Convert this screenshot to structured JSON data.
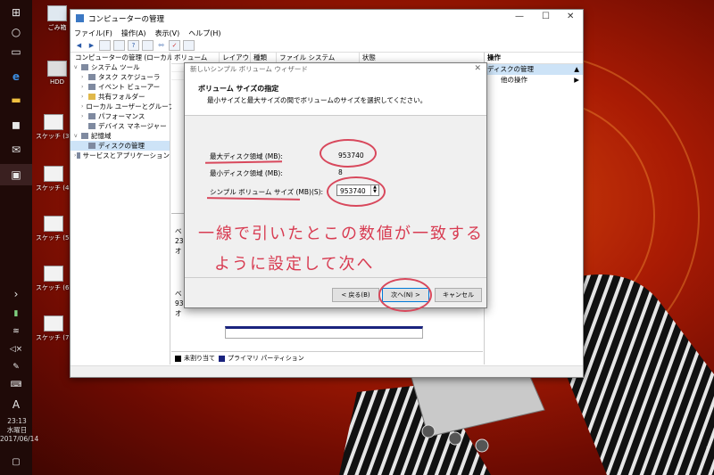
{
  "taskbar": {
    "time": "23:13",
    "weekday": "水曜日",
    "date": "2017/06/14",
    "ime": "A"
  },
  "desktop": {
    "icons": [
      "ごみ箱",
      "HDD",
      "スケッチ (3).p",
      "スケッチ (4).p",
      "スケッチ (5).p",
      "スケッチ (6).p",
      "スケッチ (7).p"
    ]
  },
  "window": {
    "title": "コンピューターの管理",
    "menu": [
      "ファイル(F)",
      "操作(A)",
      "表示(V)",
      "ヘルプ(H)"
    ],
    "tree": [
      "コンピューターの管理 (ローカル)",
      "システム ツール",
      "タスク スケジューラ",
      "イベント ビューアー",
      "共有フォルダー",
      "ローカル ユーザーとグループ",
      "パフォーマンス",
      "デバイス マネージャー",
      "記憶域",
      "ディスクの管理",
      "サービスとアプリケーション"
    ],
    "columns": [
      "ボリューム",
      "レイアウト",
      "種類",
      "ファイル システム",
      "状態"
    ],
    "disk_fragments": [
      "ベ",
      "23",
      "オ",
      "ベ",
      "93",
      "オ"
    ],
    "legend": {
      "unallocated": "未割り当て",
      "primary": "プライマリ パーティション"
    },
    "actions": {
      "header": "操作",
      "section": "ディスクの管理",
      "other": "他の操作"
    }
  },
  "wizard": {
    "title": "新しいシンプル ボリューム ウィザード",
    "heading": "ボリューム サイズの指定",
    "subheading": "最小サイズと最大サイズの間でボリュームのサイズを選択してください。",
    "max_label": "最大ディスク領域 (MB):",
    "max_value": "953740",
    "min_label": "最小ディスク領域 (MB):",
    "min_value": "8",
    "size_label": "シンプル ボリューム サイズ (MB)(S):",
    "size_value": "953740",
    "back": "< 戻る(B)",
    "next": "次へ(N) >",
    "cancel": "キャンセル"
  },
  "annotation": {
    "line1": "一線で引いたとこの数値が一致する",
    "line2": "ように設定して次へ"
  }
}
